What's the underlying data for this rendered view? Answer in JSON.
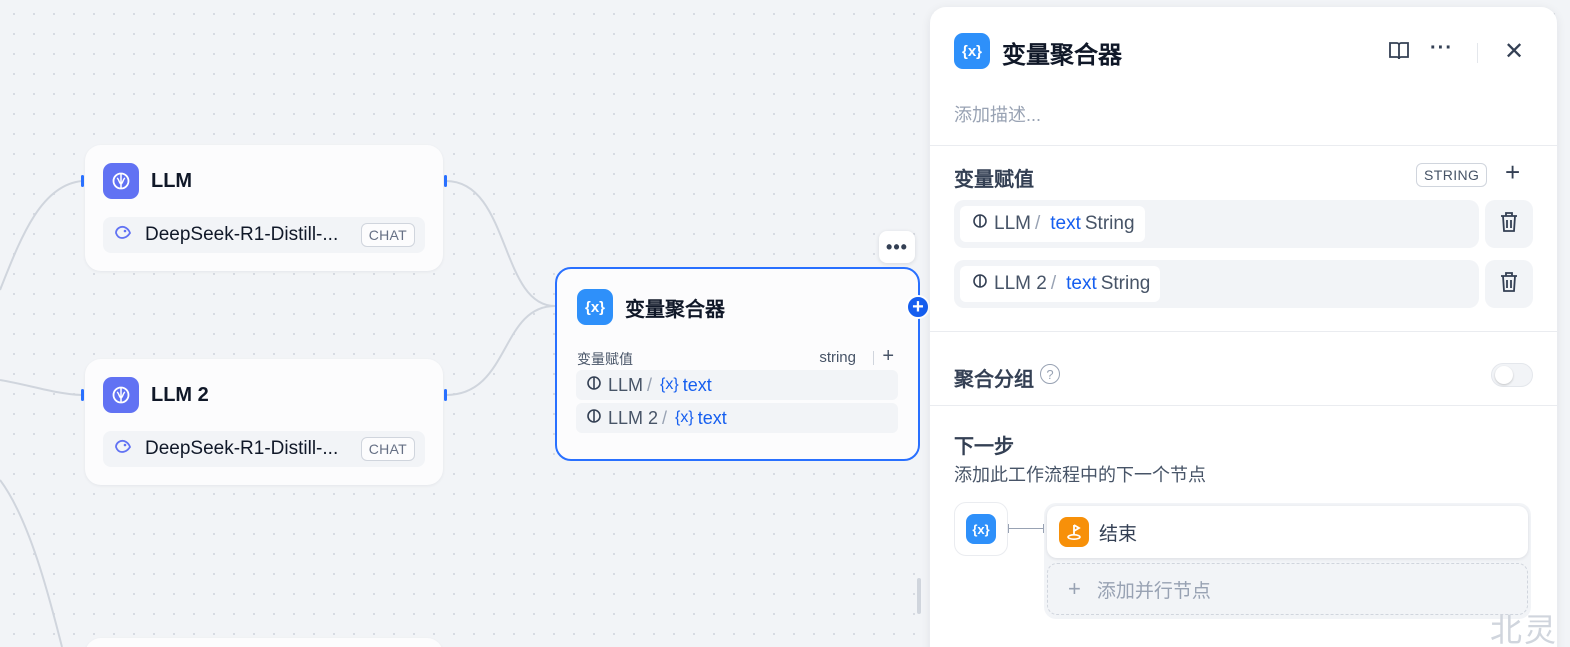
{
  "canvas": {
    "llm_nodes": [
      {
        "title": "LLM",
        "model": "DeepSeek-R1-Distill-...",
        "mode": "CHAT"
      },
      {
        "title": "LLM 2",
        "model": "DeepSeek-R1-Distill-...",
        "mode": "CHAT"
      }
    ],
    "aggregator_node": {
      "title": "变量聚合器",
      "icon_text": "{x}",
      "section_label": "变量赋值",
      "type": "string",
      "rows": [
        {
          "source": "LLM",
          "separator": "/",
          "variable_icon": "{x}",
          "variable": "text"
        },
        {
          "source": "LLM 2",
          "separator": "/",
          "variable_icon": "{x}",
          "variable": "text"
        }
      ]
    }
  },
  "panel": {
    "title": "变量聚合器",
    "icon_text": "{x}",
    "description_placeholder": "添加描述...",
    "assign": {
      "title": "变量赋值",
      "type_badge": "STRING",
      "rows": [
        {
          "source": "LLM",
          "separator": "/",
          "variable": "text",
          "type": "String"
        },
        {
          "source": "LLM 2",
          "separator": "/",
          "variable": "text",
          "type": "String"
        }
      ]
    },
    "group": {
      "title": "聚合分组",
      "help": "?",
      "enabled": false
    },
    "next": {
      "title": "下一步",
      "subtitle": "添加此工作流程中的下一个节点",
      "source_icon_text": "{x}",
      "end_node": "结束",
      "add_parallel": "添加并行节点"
    }
  },
  "watermark": "北灵",
  "colors": {
    "accent": "#155eef",
    "node_border": "#2970ff",
    "llm_icon": "#6172f3",
    "agg_icon": "#2e90fa",
    "end_icon": "#f79009"
  }
}
